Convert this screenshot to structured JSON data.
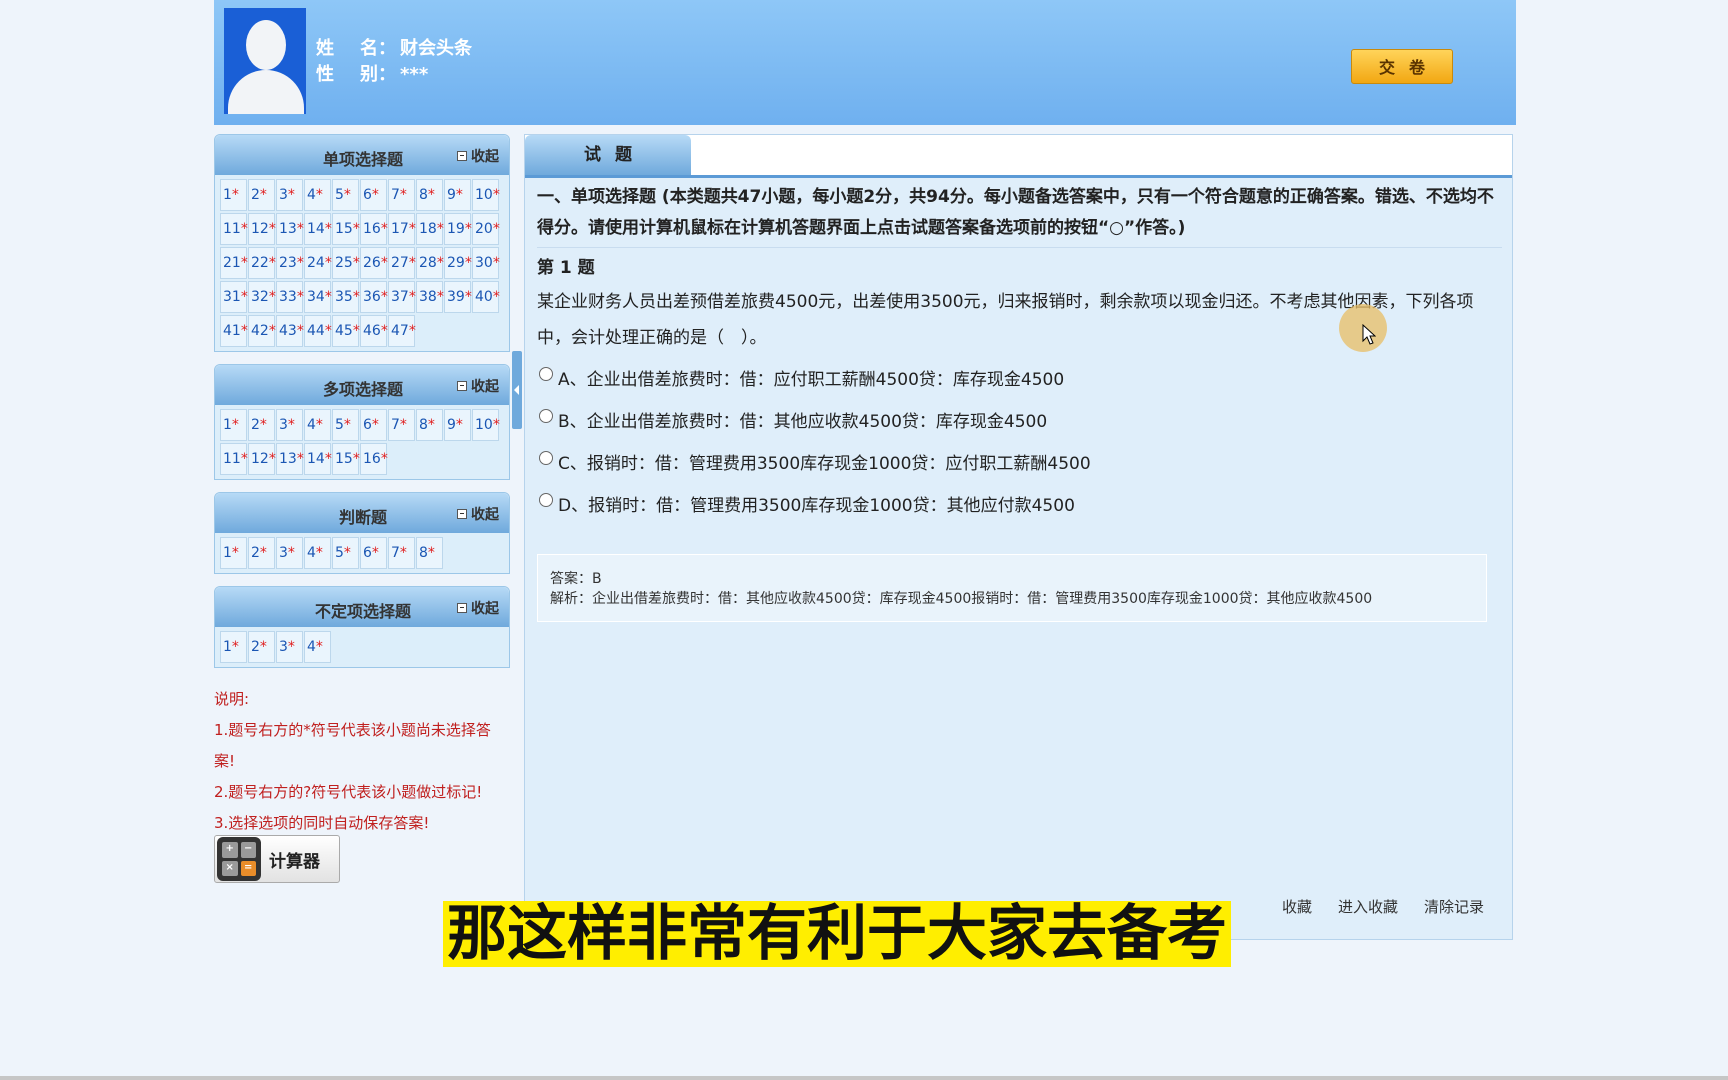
{
  "header": {
    "name_label_a": "姓",
    "name_label_b": "名",
    "name_value": "财会头条",
    "gender_label_a": "性",
    "gender_label_b": "别",
    "gender_value": "***",
    "colon": "：",
    "submit_label": "交卷"
  },
  "sidebar": {
    "panels": [
      {
        "title": "单项选择题",
        "collapse_label": "收起",
        "count": 47
      },
      {
        "title": "多项选择题",
        "collapse_label": "收起",
        "count": 16
      },
      {
        "title": "判断题",
        "collapse_label": "收起",
        "count": 8
      },
      {
        "title": "不定项选择题",
        "collapse_label": "收起",
        "count": 4
      }
    ],
    "unanswered_mark": "*",
    "notes": {
      "title": "说明:",
      "line1": "1.题号右方的*符号代表该小题尚未选择答案!",
      "line2": "2.题号右方的?符号代表该小题做过标记!",
      "line3": "3.选择选项的同时自动保存答案!"
    },
    "calculator_label": "计算器"
  },
  "main": {
    "tab_label": "试题",
    "section_text": "一、单项选择题 (本类题共47小题，每小题2分，共94分。每小题备选答案中，只有一个符合题意的正确答案。错选、不选均不得分。请使用计算机鼠标在计算机答题界面上点击试题答案备选项前的按钮“○”作答。)",
    "question_number": "第 1 题",
    "question_text": "某企业财务人员出差预借差旅费4500元，出差使用3500元，归来报销时，剩余款项以现金归还。不考虑其他因素，下列各项中，会计处理正确的是（　）。",
    "options": [
      "A、企业出借差旅费时：借：应付职工薪酬4500贷：库存现金4500",
      "B、企业出借差旅费时：借：其他应收款4500贷：库存现金4500",
      "C、报销时：借：管理费用3500库存现金1000贷：应付职工薪酬4500",
      "D、报销时：借：管理费用3500库存现金1000贷：其他应付款4500"
    ],
    "answer": "答案：B",
    "explanation": "解析：企业出借差旅费时：借：其他应收款4500贷：库存现金4500报销时：借：管理费用3500库存现金1000贷：其他应收款4500",
    "bottom_links": {
      "favorite": "收藏",
      "enter_favorites": "进入收藏",
      "clear_records": "清除记录"
    }
  },
  "caption": "那这样非常有利于大家去备考"
}
